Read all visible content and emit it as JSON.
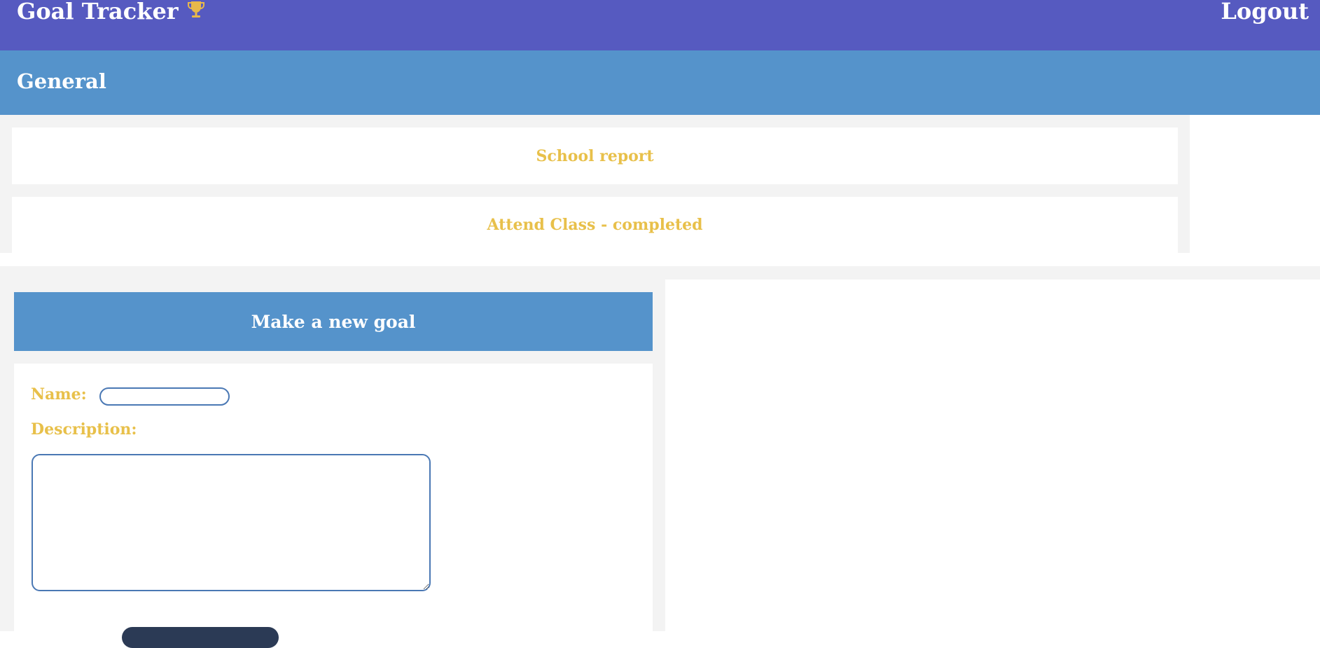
{
  "header": {
    "app_title": "Goal Tracker",
    "trophy_icon": "trophy-icon",
    "logout_label": "Logout"
  },
  "section": {
    "title": "General"
  },
  "goals": [
    {
      "label": "School report"
    },
    {
      "label": "Attend Class - completed"
    }
  ],
  "new_goal_form": {
    "title": "Make a new goal",
    "name_label": "Name:",
    "name_value": "",
    "description_label": "Description:",
    "description_value": "",
    "submit_label": ""
  },
  "colors": {
    "topbar": "#565ac0",
    "section_bar": "#5593cb",
    "accent_text": "#e8c04a",
    "panel_bg": "#f3f3f3",
    "input_border": "#4a78b4",
    "button_bg": "#2b3a55"
  }
}
